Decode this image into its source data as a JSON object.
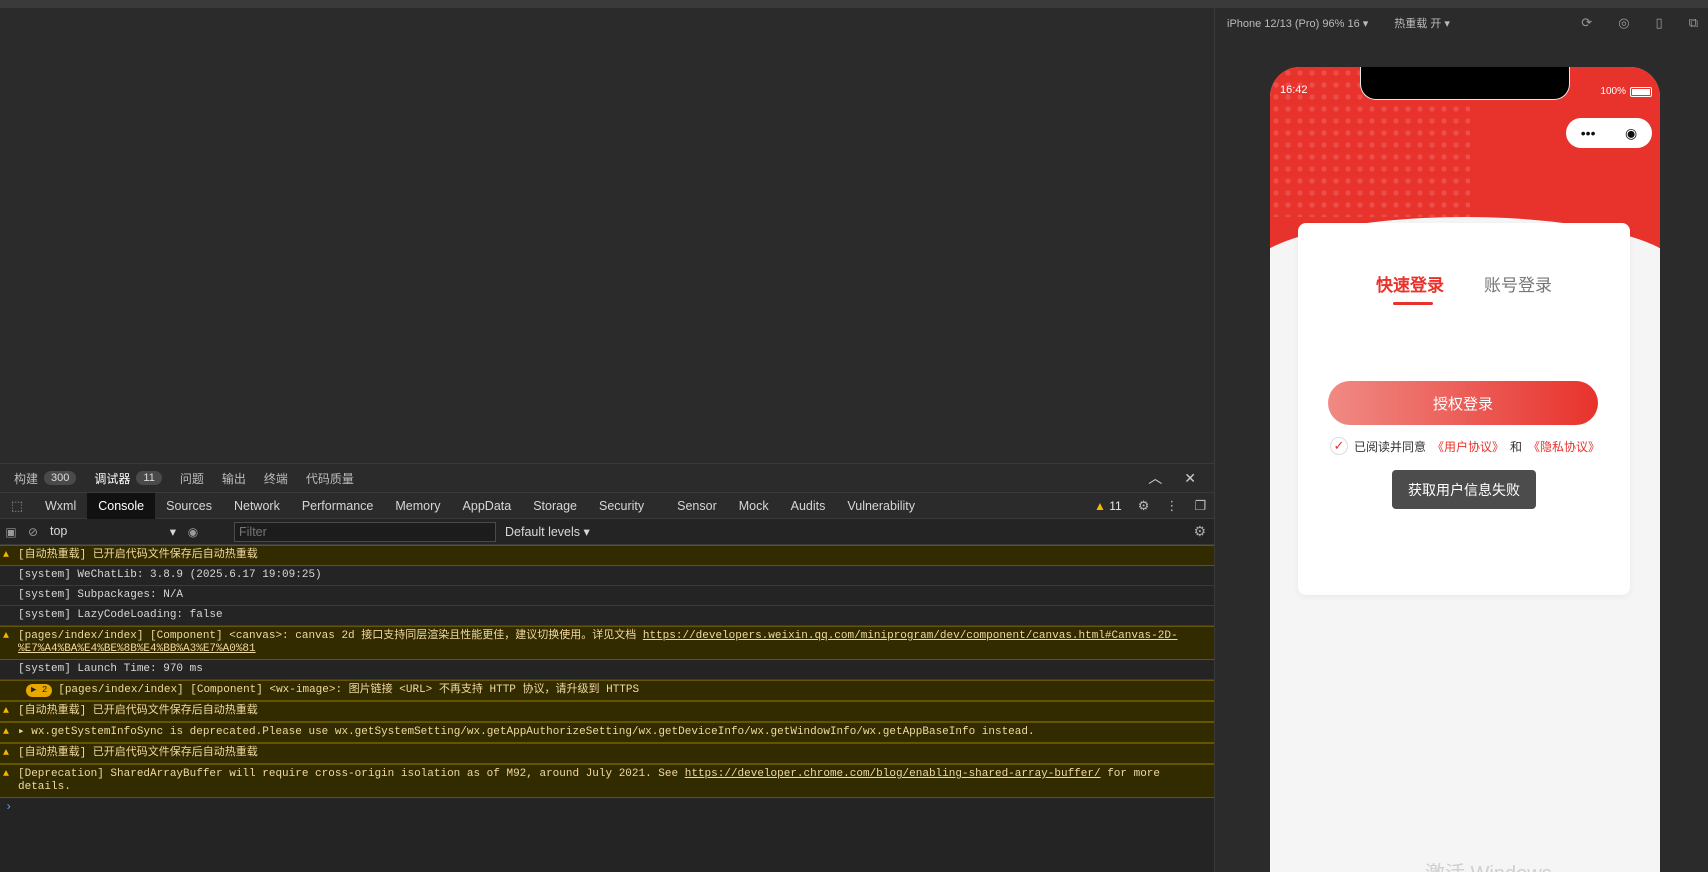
{
  "devtools": {
    "panel_tabs": [
      {
        "label": "构建",
        "badge": "300"
      },
      {
        "label": "调试器",
        "badge": "11"
      },
      {
        "label": "问题"
      },
      {
        "label": "输出"
      },
      {
        "label": "终端"
      },
      {
        "label": "代码质量"
      }
    ],
    "tabs": [
      "Wxml",
      "Console",
      "Sources",
      "Network",
      "Performance",
      "Memory",
      "AppData",
      "Storage",
      "Security",
      "Sensor",
      "Mock",
      "Audits",
      "Vulnerability"
    ],
    "active_tab": "Console",
    "warning_count": "11",
    "context": "top",
    "filter_placeholder": "Filter",
    "levels": "Default levels",
    "messages": [
      {
        "type": "warn",
        "text": "[自动热重载] 已开启代码文件保存后自动热重载"
      },
      {
        "type": "info",
        "text": "[system] WeChatLib: 3.8.9 (2025.6.17 19:09:25)"
      },
      {
        "type": "info",
        "text": "[system] Subpackages: N/A"
      },
      {
        "type": "info",
        "text": "[system] LazyCodeLoading: false"
      },
      {
        "type": "warn",
        "text": "[pages/index/index] [Component] <canvas>: canvas 2d 接口支持同层渲染且性能更佳，建议切换使用。详见文档 ",
        "link": "https://developers.weixin.qq.com/miniprogram/dev/component/canvas.html#Canvas-2D-%E7%A4%BA%E4%BE%8B%E4%BB%A3%E7%A0%81"
      },
      {
        "type": "info",
        "text": "[system] Launch Time: 970 ms"
      },
      {
        "type": "warn",
        "pill": "▶ 2",
        "text": "[pages/index/index] [Component] <wx-image>: 图片链接 <URL> 不再支持 HTTP 协议，请升级到 HTTPS"
      },
      {
        "type": "warn",
        "text": "[自动热重载] 已开启代码文件保存后自动热重载"
      },
      {
        "type": "warn",
        "text": "▸ wx.getSystemInfoSync is deprecated.Please use wx.getSystemSetting/wx.getAppAuthorizeSetting/wx.getDeviceInfo/wx.getWindowInfo/wx.getAppBaseInfo instead."
      },
      {
        "type": "warn",
        "text": "[自动热重载] 已开启代码文件保存后自动热重载"
      },
      {
        "type": "warn",
        "text": "[Deprecation] SharedArrayBuffer will require cross-origin isolation as of M92, around July 2021. See ",
        "link": "https://developer.chrome.com/blog/enabling-shared-array-buffer/",
        "suffix": " for more details."
      }
    ]
  },
  "simulator": {
    "device": "iPhone 12/13 (Pro) 96% 16 ▾",
    "hot_reload": "热重载 开 ▾",
    "status_time": "16:42",
    "battery": "100%",
    "capsule_more": "•••",
    "capsule_close": "◉",
    "tab_quick": "快速登录",
    "tab_account": "账号登录",
    "auth_button": "授权登录",
    "agree_prefix": "已阅读并同意",
    "user_agreement": "《用户协议》",
    "and": "和",
    "privacy_agreement": "《隐私协议》",
    "fail_button": "获取用户信息失败",
    "watermark": "激活 Windows"
  }
}
